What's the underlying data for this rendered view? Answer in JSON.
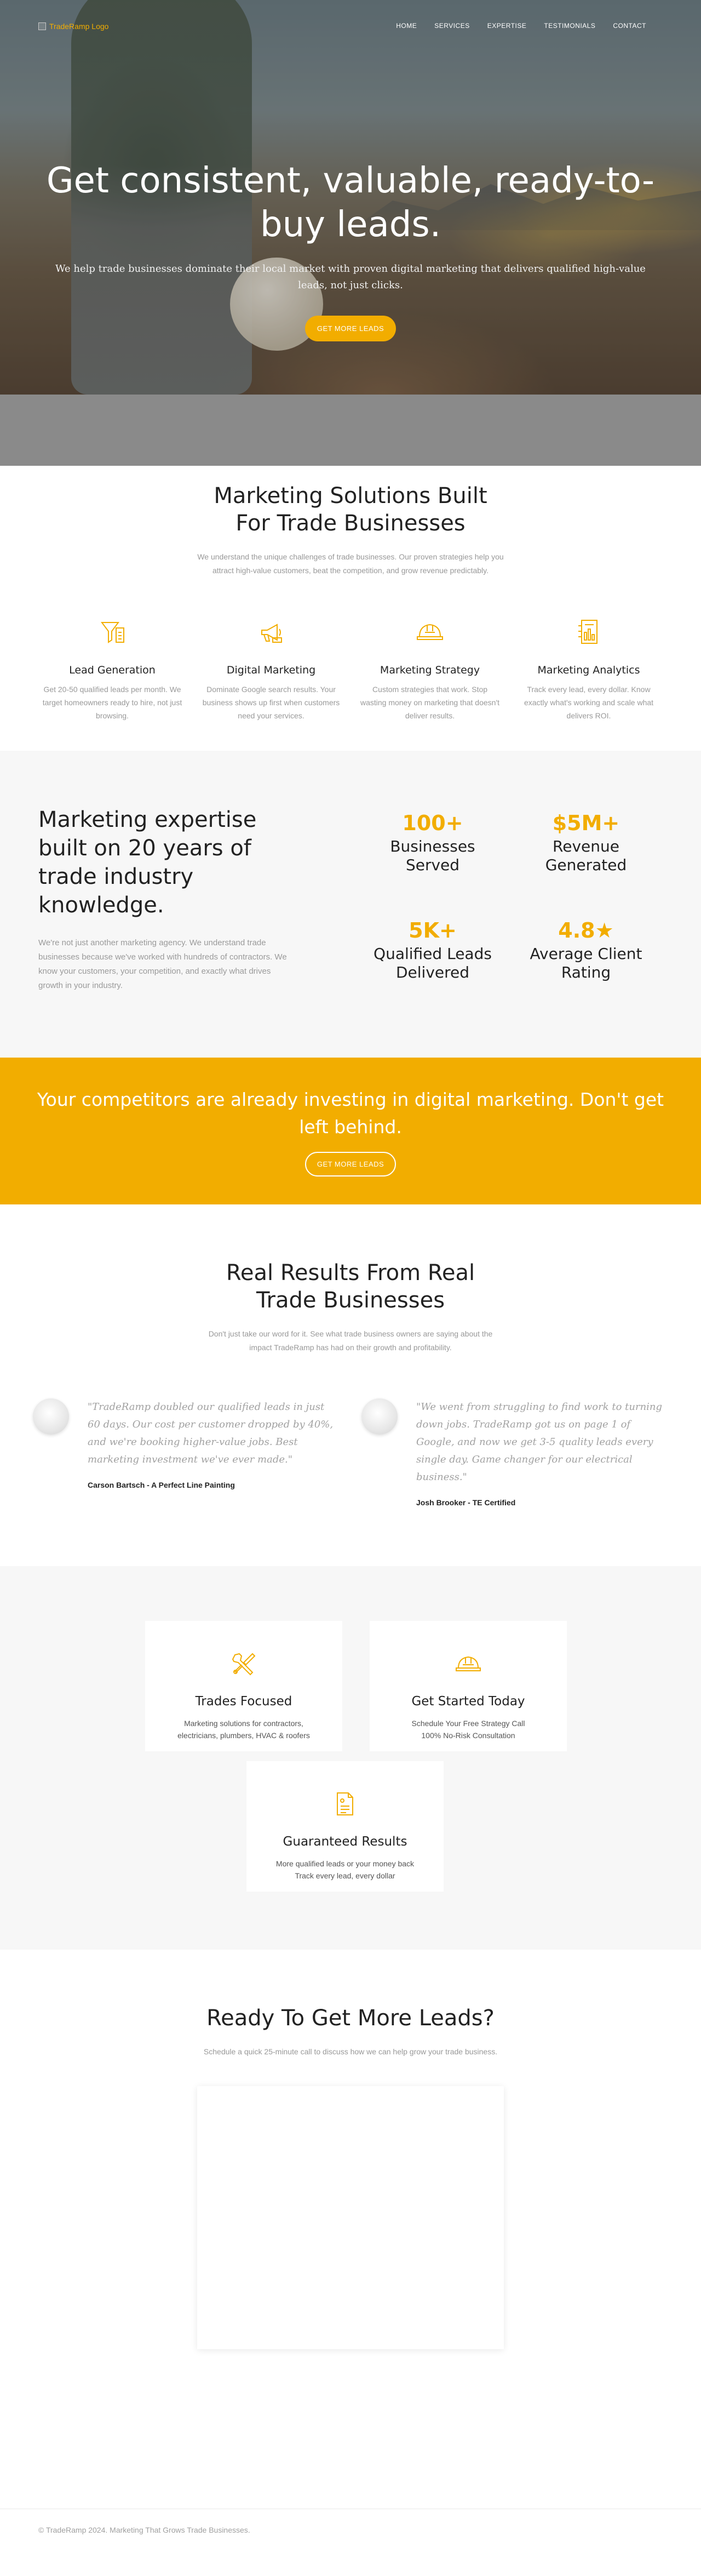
{
  "nav": {
    "logo_text": "TradeRamp Logo",
    "items": [
      "HOME",
      "SERVICES",
      "EXPERTISE",
      "TESTIMONIALS",
      "CONTACT"
    ]
  },
  "hero": {
    "title": "Get consistent, valuable, ready-to-buy leads.",
    "subtitle": "We help trade businesses dominate their local market with proven digital marketing that delivers qualified high-value leads, not just clicks.",
    "cta": "GET MORE LEADS"
  },
  "solutions": {
    "title": "Marketing Solutions Built For Trade Businesses",
    "description": "We understand the unique challenges of trade businesses. Our proven strategies help you attract high-value customers, beat the competition, and grow revenue predictably.",
    "items": [
      {
        "icon": "funnel-icon",
        "title": "Lead Generation",
        "desc": "Get 20-50 qualified leads per month. We target homeowners ready to hire, not just browsing."
      },
      {
        "icon": "megaphone-icon",
        "title": "Digital Marketing",
        "desc": "Dominate Google search results. Your business shows up first when customers need your services."
      },
      {
        "icon": "hard-hat-icon",
        "title": "Marketing Strategy",
        "desc": "Custom strategies that work. Stop wasting money on marketing that doesn't deliver results."
      },
      {
        "icon": "analytics-icon",
        "title": "Marketing Analytics",
        "desc": "Track every lead, every dollar. Know exactly what's working and scale what delivers ROI."
      }
    ]
  },
  "expertise": {
    "title": "Marketing expertise built on 20 years of trade industry knowledge.",
    "description": "We're not just another marketing agency. We understand trade businesses because we've worked with hundreds of contractors. We know your customers, your competition, and exactly what drives growth in your industry.",
    "stats": [
      {
        "value": "100+",
        "label": "Businesses Served"
      },
      {
        "value": "$5M+",
        "label": "Revenue Generated"
      },
      {
        "value": "5K+",
        "label": "Qualified Leads Delivered"
      },
      {
        "value": "4.8★",
        "label": "Average Client Rating"
      }
    ]
  },
  "banner": {
    "text": "Your competitors are already investing in digital marketing. Don't get left behind.",
    "cta": "GET MORE LEADS"
  },
  "testimonials": {
    "title": "Real Results From Real Trade Businesses",
    "description": "Don't just take our word for it. See what trade business owners are saying about the impact TradeRamp has had on their growth and profitability.",
    "items": [
      {
        "quote": "\"TradeRamp doubled our qualified leads in just 60 days. Our cost per customer dropped by 40%, and we're booking higher-value jobs. Best marketing investment we've ever made.\"",
        "author": "Carson Bartsch - A Perfect Line Painting"
      },
      {
        "quote": "\"We went from struggling to find work to turning down jobs. TradeRamp got us on page 1 of Google, and now we get 3-5 quality leads every single day. Game changer for our electrical business.\"",
        "author": "Josh Brooker - TE Certified"
      }
    ]
  },
  "features": [
    {
      "icon": "tools-icon",
      "title": "Trades Focused",
      "line1": "Marketing solutions for contractors,",
      "line2": "electricians, plumbers, HVAC & roofers"
    },
    {
      "icon": "hard-hat-icon",
      "title": "Get Started Today",
      "line1": "Schedule Your Free Strategy Call",
      "line2": "100% No-Risk Consultation"
    },
    {
      "icon": "document-icon",
      "title": "Guaranteed Results",
      "line1": "More qualified leads or your money back",
      "line2": "Track every lead, every dollar"
    }
  ],
  "booking": {
    "title": "Ready To Get More Leads?",
    "description": "Schedule a quick 25-minute call to discuss how we can help grow your trade business."
  },
  "footer": {
    "text": "© TradeRamp 2024. Marketing That Grows Trade Businesses."
  },
  "colors": {
    "accent": "#f2ad00",
    "section_gray": "#f7f7f7"
  }
}
